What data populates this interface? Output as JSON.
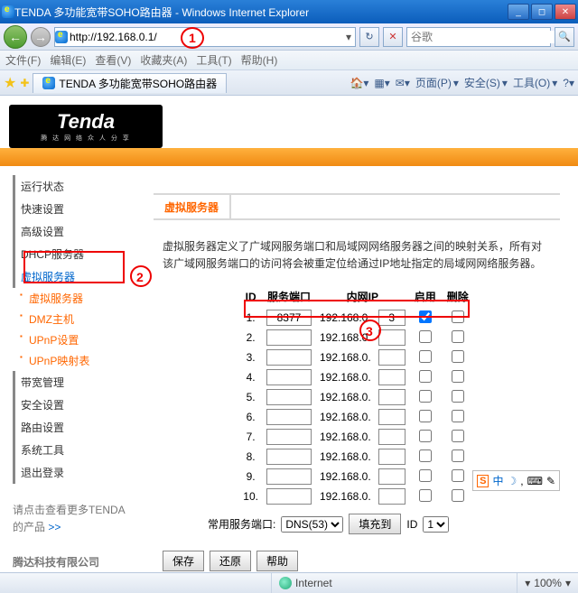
{
  "window": {
    "title": "TENDA 多功能宽带SOHO路由器 - Windows Internet Explorer"
  },
  "nav": {
    "url": "http://192.168.0.1/",
    "search_placeholder": "谷歌"
  },
  "menu": {
    "file": "文件(F)",
    "edit": "编辑(E)",
    "view": "查看(V)",
    "fav": "收藏夹(A)",
    "tools": "工具(T)",
    "help": "帮助(H)"
  },
  "tab": {
    "label": "TENDA 多功能宽带SOHO路由器"
  },
  "toolbar": {
    "home": "",
    "page": "页面(P)",
    "safety": "安全(S)",
    "tools": "工具(O)"
  },
  "sidebar": {
    "items": [
      "运行状态",
      "快速设置",
      "高级设置",
      "DHCP服务器",
      "虚拟服务器",
      "DMZ主机",
      "UPnP设置",
      "UPnP映射表",
      "带宽管理",
      "安全设置",
      "路由设置",
      "系统工具",
      "退出登录"
    ],
    "sub_virtual": "虚拟服务器",
    "note1": "请点击查看更多TENDA的产品 ",
    "note_link": ">>",
    "company": "腾达科技有限公司"
  },
  "panel": {
    "title": "虚拟服务器",
    "desc": "虚拟服务器定义了广域网服务端口和局域网网络服务器之间的映射关系，所有对该广域网服务端口的访问将会被重定位给通过IP地址指定的局域网网络服务器。",
    "headers": {
      "id": "ID",
      "port": "服务端口",
      "ip": "内网IP",
      "enable": "启用",
      "delete": "删除"
    },
    "ip_prefix": "192.168.0.",
    "rows": [
      {
        "id": "1.",
        "port": "8377",
        "ip": "3",
        "enabled": true
      },
      {
        "id": "2.",
        "port": "",
        "ip": "",
        "enabled": false
      },
      {
        "id": "3.",
        "port": "",
        "ip": "",
        "enabled": false
      },
      {
        "id": "4.",
        "port": "",
        "ip": "",
        "enabled": false
      },
      {
        "id": "5.",
        "port": "",
        "ip": "",
        "enabled": false
      },
      {
        "id": "6.",
        "port": "",
        "ip": "",
        "enabled": false
      },
      {
        "id": "7.",
        "port": "",
        "ip": "",
        "enabled": false
      },
      {
        "id": "8.",
        "port": "",
        "ip": "",
        "enabled": false
      },
      {
        "id": "9.",
        "port": "",
        "ip": "",
        "enabled": false
      },
      {
        "id": "10.",
        "port": "",
        "ip": "",
        "enabled": false
      }
    ],
    "common_port_label": "常用服务端口:",
    "common_port_value": "DNS(53)",
    "fill": "填充到",
    "id_label": "ID",
    "id_value": "1",
    "save": "保存",
    "restore": "还原",
    "help": "帮助"
  },
  "status": {
    "zone": "Internet",
    "zoom": "100%"
  },
  "ime": {
    "s": "S",
    "zh": "中"
  },
  "annotations": {
    "a1": "1",
    "a2": "2",
    "a3": "3"
  }
}
